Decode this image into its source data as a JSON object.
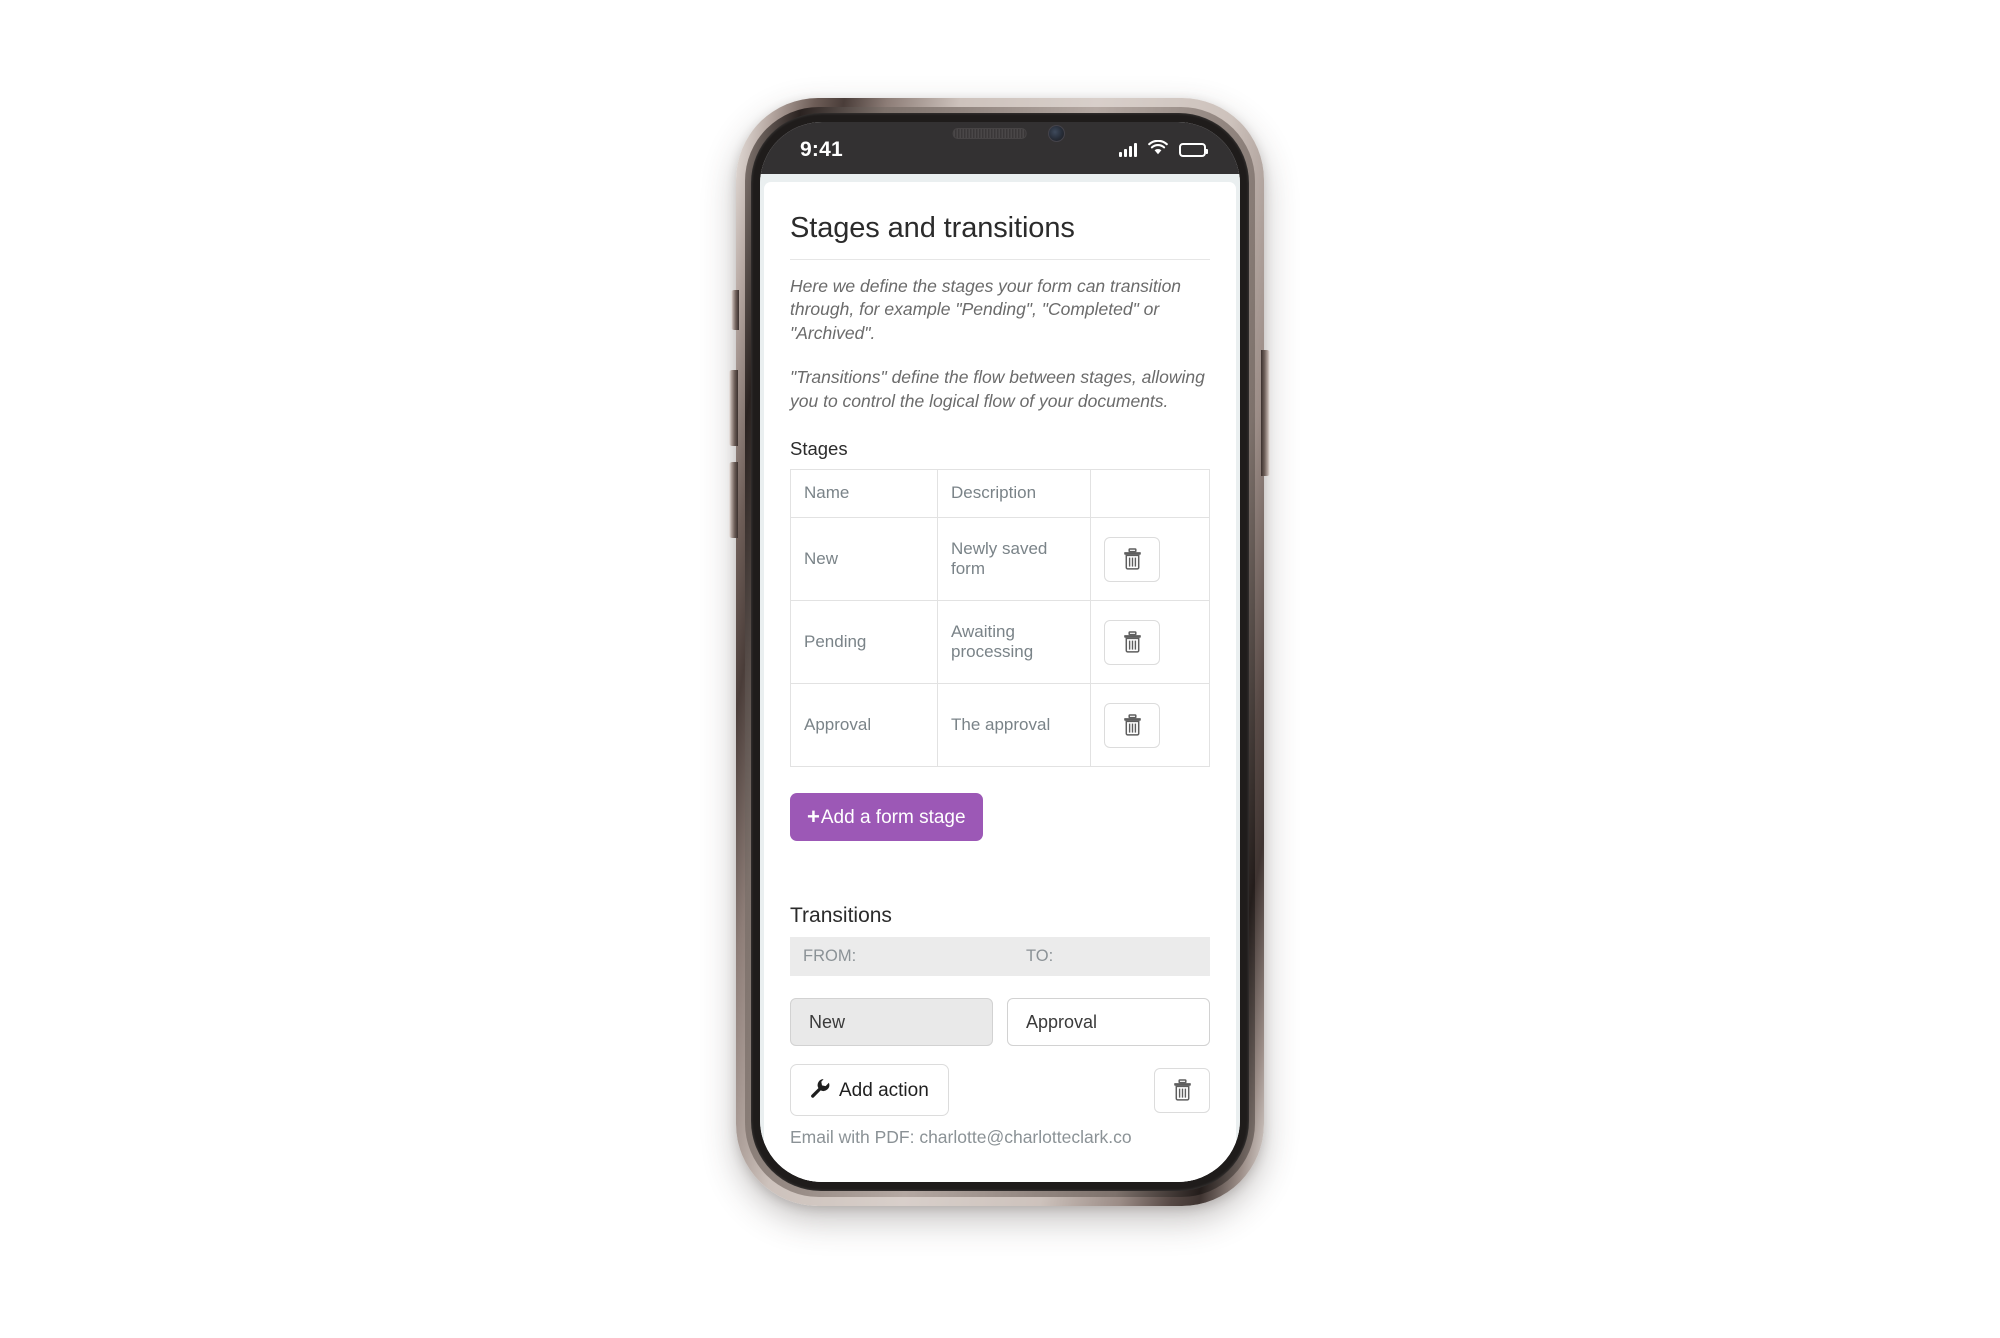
{
  "device": {
    "statusbar": {
      "time": "9:41",
      "signal_icon": "signal-bars-icon",
      "wifi_icon": "wifi-icon",
      "battery_icon": "battery-full-icon"
    }
  },
  "page": {
    "title": "Stages and transitions",
    "intro_paragraphs": [
      "Here we define the stages your form can transition through, for example \"Pending\", \"Completed\" or \"Archived\".",
      "\"Transitions\" define the flow between stages, allowing you to control the logical flow of your documents."
    ],
    "stages": {
      "heading": "Stages",
      "columns": [
        "Name",
        "Description",
        ""
      ],
      "rows": [
        {
          "name": "New",
          "description": "Newly saved form",
          "delete_icon": "trash-icon"
        },
        {
          "name": "Pending",
          "description": "Awaiting processing",
          "delete_icon": "trash-icon"
        },
        {
          "name": "Approval",
          "description": "The approval",
          "delete_icon": "trash-icon"
        }
      ],
      "add_button": {
        "label": "Add a form stage",
        "icon": "plus-icon",
        "color": "#9c58b6"
      }
    },
    "transitions": {
      "heading": "Transitions",
      "from_label": "FROM:",
      "to_label": "TO:",
      "rows": [
        {
          "from_value": "New",
          "to_value": "Approval",
          "add_action_label": "Add action",
          "add_action_icon": "wrench-icon",
          "delete_icon": "trash-icon",
          "action_summary": "Email with PDF: charlotte@charlotteclark.co"
        }
      ]
    }
  }
}
